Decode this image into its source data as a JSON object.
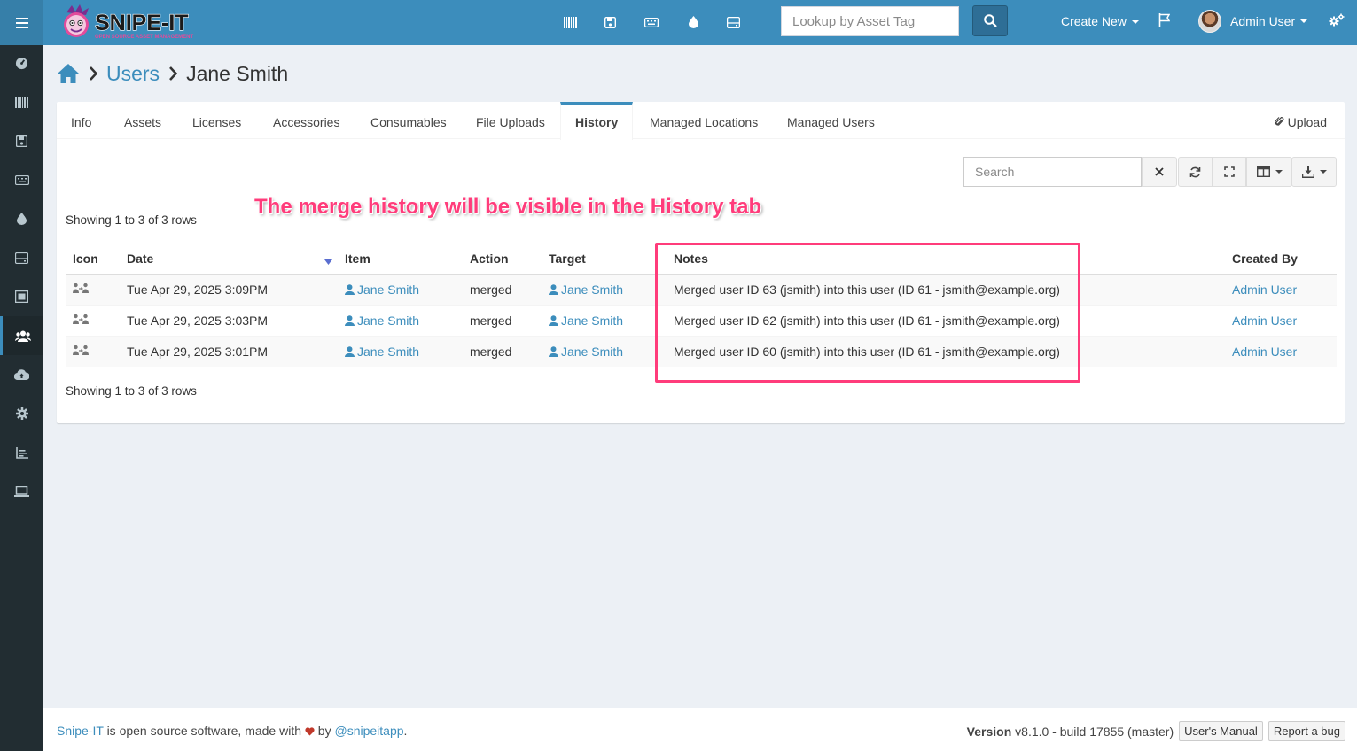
{
  "app": {
    "logo_text": "SNIPE-IT",
    "logo_tagline": "OPEN SOURCE ASSET MANAGEMENT"
  },
  "header": {
    "lookup_placeholder": "Lookup by Asset Tag",
    "create_new_label": "Create New",
    "user_name": "Admin User",
    "icons": [
      "barcode-icon",
      "save-icon",
      "keyboard-icon",
      "tint-icon",
      "hdd-icon",
      "search-icon",
      "flag-icon",
      "gears-icon"
    ]
  },
  "sidebar": {
    "items": [
      "dashboard-icon",
      "barcode-icon",
      "save-icon",
      "keyboard-icon",
      "tint-icon",
      "hdd-icon",
      "kit-icon",
      "users-icon",
      "cloud-upload-icon",
      "settings-icon",
      "reports-icon",
      "laptop-icon"
    ],
    "active_item": "users-icon"
  },
  "breadcrumb": {
    "users_label": "Users",
    "current_label": "Jane Smith"
  },
  "tabs": {
    "items": [
      "Info",
      "Assets",
      "Licenses",
      "Accessories",
      "Consumables",
      "File Uploads",
      "History",
      "Managed Locations",
      "Managed Users"
    ],
    "active": "History",
    "upload_label": "Upload"
  },
  "toolbar": {
    "search_placeholder": "Search"
  },
  "annotation": {
    "text": "The merge history will be visible in the History tab"
  },
  "table": {
    "showing_top": "Showing 1 to 3 of 3 rows",
    "showing_bottom": "Showing 1 to 3 of 3 rows",
    "columns": [
      "Icon",
      "Date",
      "Item",
      "Action",
      "Target",
      "Notes",
      "Created By"
    ],
    "rows": [
      {
        "date": "Tue Apr 29, 2025 3:09PM",
        "item": "Jane Smith",
        "action": "merged",
        "target": "Jane Smith",
        "notes": "Merged user ID 63 (jsmith) into this user (ID 61 - jsmith@example.org)",
        "created_by": "Admin User"
      },
      {
        "date": "Tue Apr 29, 2025 3:03PM",
        "item": "Jane Smith",
        "action": "merged",
        "target": "Jane Smith",
        "notes": "Merged user ID 62 (jsmith) into this user (ID 61 - jsmith@example.org)",
        "created_by": "Admin User"
      },
      {
        "date": "Tue Apr 29, 2025 3:01PM",
        "item": "Jane Smith",
        "action": "merged",
        "target": "Jane Smith",
        "notes": "Merged user ID 60 (jsmith) into this user (ID 61 - jsmith@example.org)",
        "created_by": "Admin User"
      }
    ]
  },
  "footer": {
    "brand_link": "Snipe-IT",
    "text_middle": "is open source software, made with",
    "text_by": "by",
    "handle_link": "@snipeitapp",
    "period": ".",
    "version_label": "Version",
    "version_value": "v8.1.0 - build 17855 (master)",
    "manual_button": "User's Manual",
    "bug_button": "Report a bug"
  },
  "colors": {
    "header_blue": "#3c8dbc",
    "sidebar_dark": "#222d32",
    "highlight_pink": "#ff3c7b",
    "link_blue": "#3c8dbc"
  }
}
